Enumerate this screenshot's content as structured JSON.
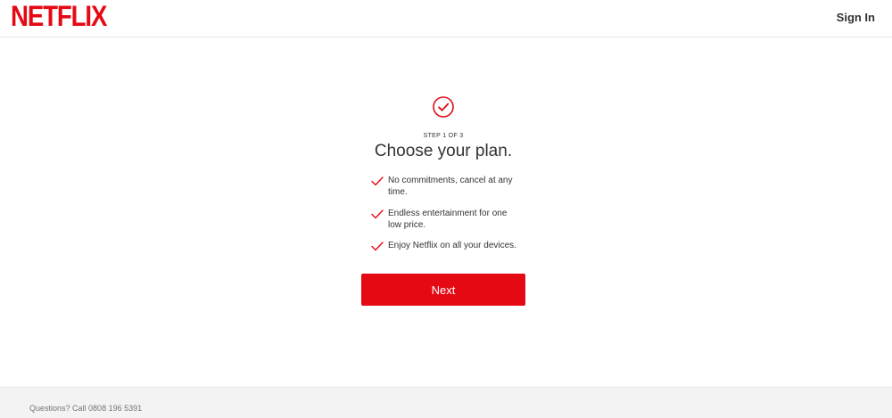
{
  "header": {
    "logo_text": "NETFLIX",
    "sign_in_label": "Sign In"
  },
  "main": {
    "step_label": "STEP 1 OF 3",
    "title": "Choose your plan.",
    "benefits": [
      "No commitments, cancel at any time.",
      "Endless entertainment for one low price.",
      "Enjoy Netflix on all your devices."
    ],
    "next_label": "Next"
  },
  "footer": {
    "questions_prefix": "Questions? Call ",
    "phone": "0808 196 5391"
  },
  "colors": {
    "brand_red": "#e50914",
    "text": "#333333",
    "footer_bg": "#f3f3f3",
    "footer_text": "#737373"
  },
  "icons": {
    "header_check": "check-circle-icon",
    "benefit_check": "checkmark-icon"
  }
}
